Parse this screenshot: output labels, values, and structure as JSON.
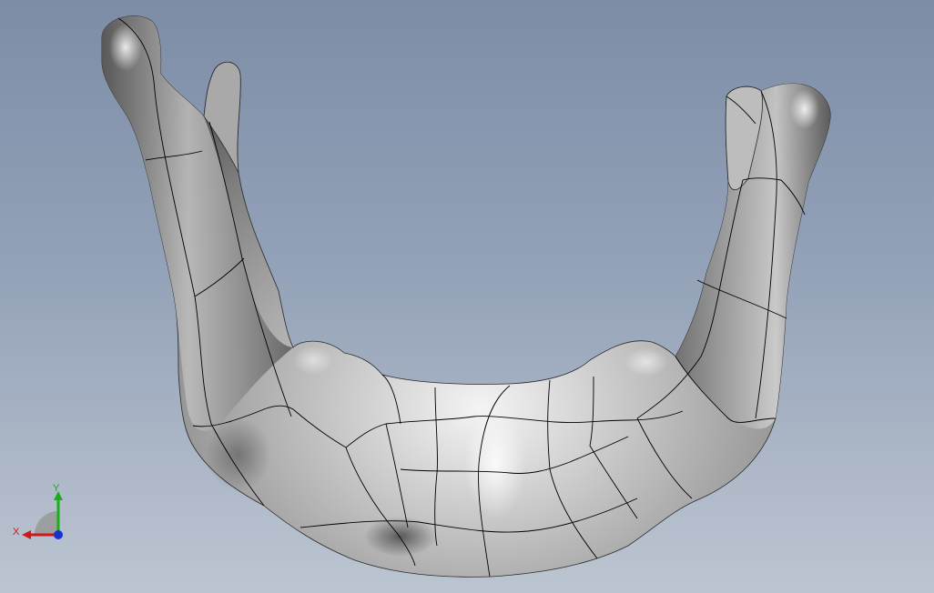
{
  "viewport": {
    "background_top": "#7d8da6",
    "background_bottom": "#bcc5d1",
    "model": "mandible-surface-model",
    "edge_color": "#000000"
  },
  "triad": {
    "x_label": "X",
    "y_label": "Y",
    "x_color": "#d01818",
    "y_color": "#18b018",
    "z_color": "#1830d0"
  }
}
